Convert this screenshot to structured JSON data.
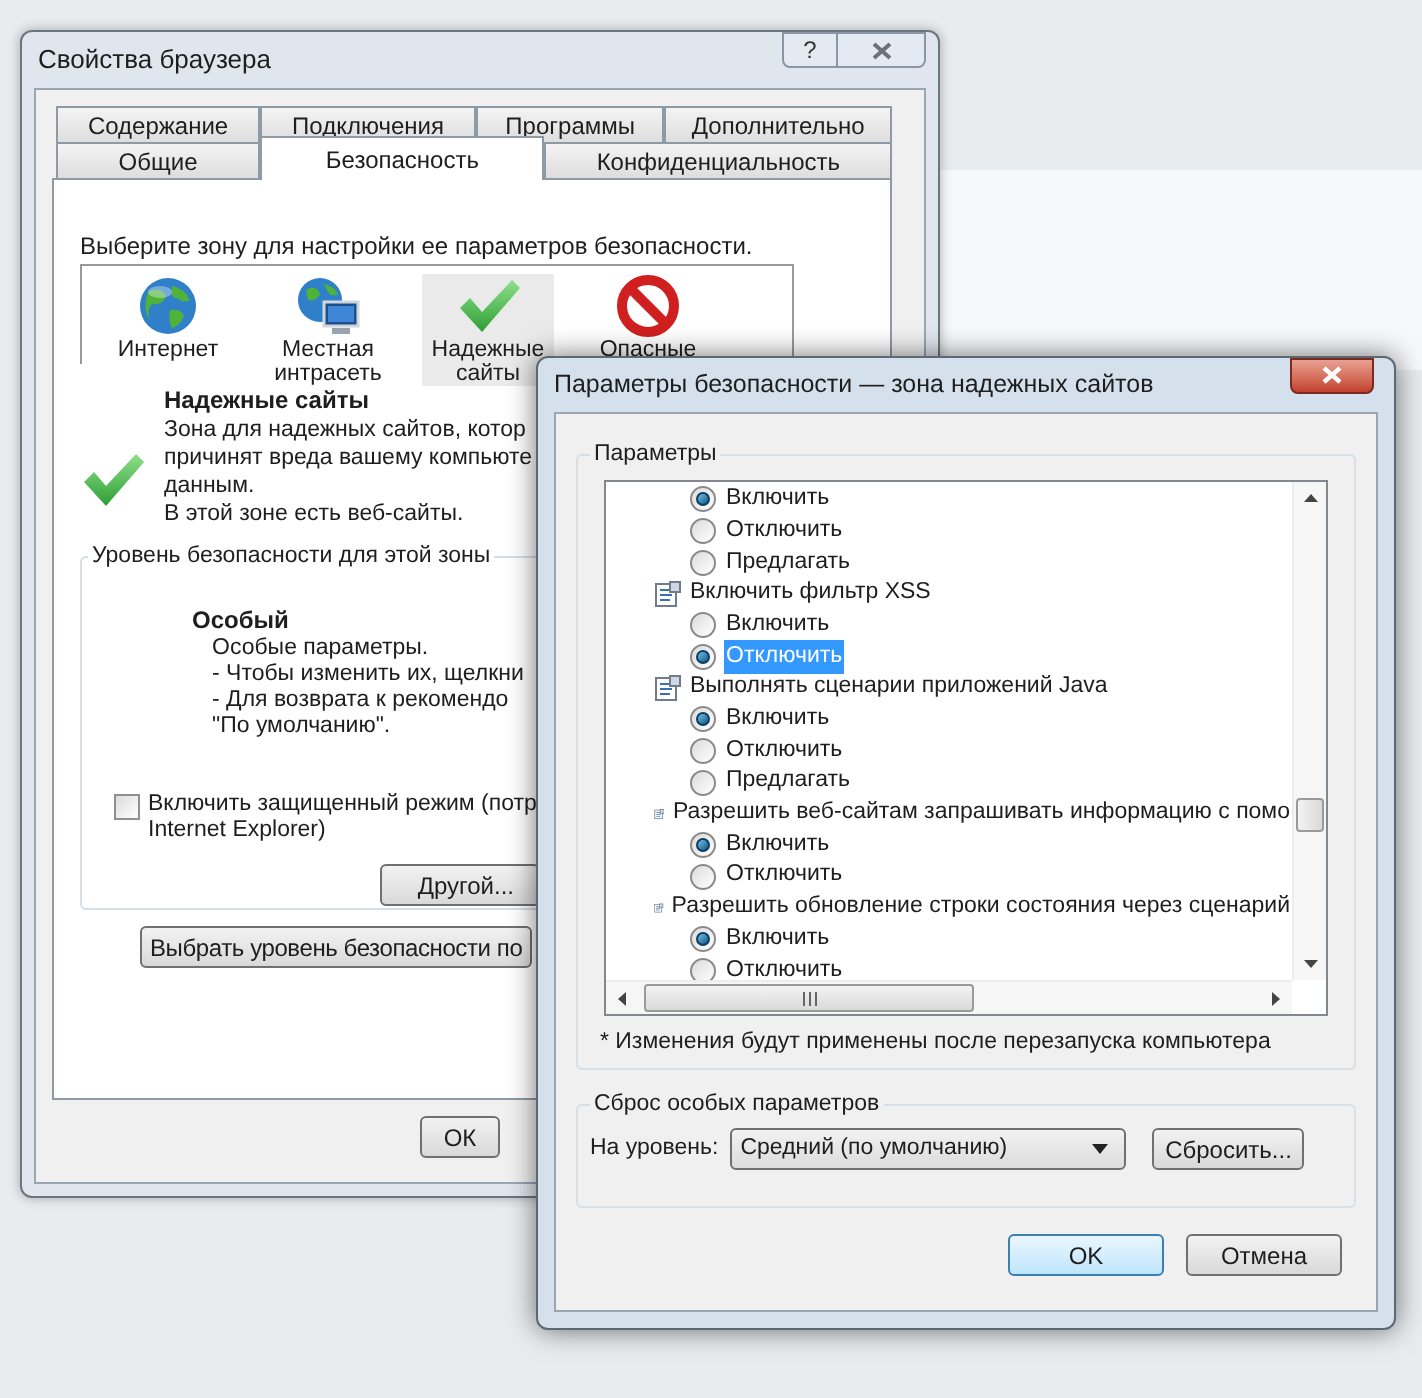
{
  "back_window": {
    "title": "Свойства браузера",
    "help": "?",
    "tab_rows": [
      [
        {
          "label": "Содержание",
          "selected": false
        },
        {
          "label": "Подключения",
          "selected": false
        },
        {
          "label": "Программы",
          "selected": false
        },
        {
          "label": "Дополнительно",
          "selected": false
        }
      ],
      [
        {
          "label": "Общие",
          "selected": false
        },
        {
          "label": "Безопасность",
          "selected": true
        },
        {
          "label": "Конфиденциальность",
          "selected": false
        }
      ]
    ],
    "zone_prompt": "Выберите зону для настройки ее параметров безопасности.",
    "zones": [
      {
        "kind": "globe",
        "label": "Интернет",
        "selected": false
      },
      {
        "kind": "intranet",
        "label": "Местная интрасеть",
        "selected": false
      },
      {
        "kind": "check",
        "label": "Надежные сайты",
        "selected": true
      },
      {
        "kind": "forbidden",
        "label": "Опасные",
        "selected": false
      }
    ],
    "zone_title": "Надежные сайты",
    "zone_description": [
      "Зона для надежных сайтов, котор",
      "причинят вреда вашему компьюте",
      "данным.",
      "В этой зоне есть веб-сайты."
    ],
    "level_group": {
      "label": "Уровень безопасности для этой зоны",
      "level_name": "Особый",
      "level_lines": [
        "Особые параметры.",
        "- Чтобы изменить их, щелкни",
        "- Для возврата к рекомендо",
        "\"По умолчанию\"."
      ],
      "protected_mode": {
        "label": [
          "Включить защищенный режим (потр",
          "Internet Explorer)"
        ],
        "checked": false
      },
      "custom_button": "Другой..."
    },
    "default_level_button": "Выбрать уровень безопасности по",
    "ok_button": "ОК"
  },
  "front_window": {
    "title": "Параметры безопасности — зона надежных сайтов",
    "settings_group": "Параметры",
    "items": [
      {
        "kind": "option",
        "label": "Включить",
        "selected": true,
        "focused": false
      },
      {
        "kind": "option",
        "label": "Отключить",
        "selected": false,
        "focused": false
      },
      {
        "kind": "option",
        "label": "Предлагать",
        "selected": false,
        "focused": false
      },
      {
        "kind": "setting",
        "label": "Включить фильтр XSS"
      },
      {
        "kind": "option",
        "label": "Включить",
        "selected": false,
        "focused": false
      },
      {
        "kind": "option",
        "label": "Отключить",
        "selected": true,
        "focused": true
      },
      {
        "kind": "setting",
        "label": "Выполнять сценарии приложений Java"
      },
      {
        "kind": "option",
        "label": "Включить",
        "selected": true,
        "focused": false
      },
      {
        "kind": "option",
        "label": "Отключить",
        "selected": false,
        "focused": false
      },
      {
        "kind": "option",
        "label": "Предлагать",
        "selected": false,
        "focused": false
      },
      {
        "kind": "setting",
        "label": "Разрешить веб-сайтам запрашивать информацию с помо"
      },
      {
        "kind": "option",
        "label": "Включить",
        "selected": true,
        "focused": false
      },
      {
        "kind": "option",
        "label": "Отключить",
        "selected": false,
        "focused": false
      },
      {
        "kind": "setting",
        "label": "Разрешить обновление строки состояния через сценарий"
      },
      {
        "kind": "option",
        "label": "Включить",
        "selected": true,
        "focused": false
      },
      {
        "kind": "option",
        "label": "Отключить",
        "selected": false,
        "focused": false
      }
    ],
    "restart_note": "* Изменения будут применены после перезапуска компьютера",
    "reset_group": {
      "label": "Сброс особых параметров",
      "level_label": "На уровень:",
      "level_value": "Средний (по умолчанию)",
      "reset_button": "Сбросить..."
    },
    "buttons": [
      {
        "label": "OK",
        "default": true
      },
      {
        "label": "Отмена",
        "default": false
      }
    ]
  }
}
